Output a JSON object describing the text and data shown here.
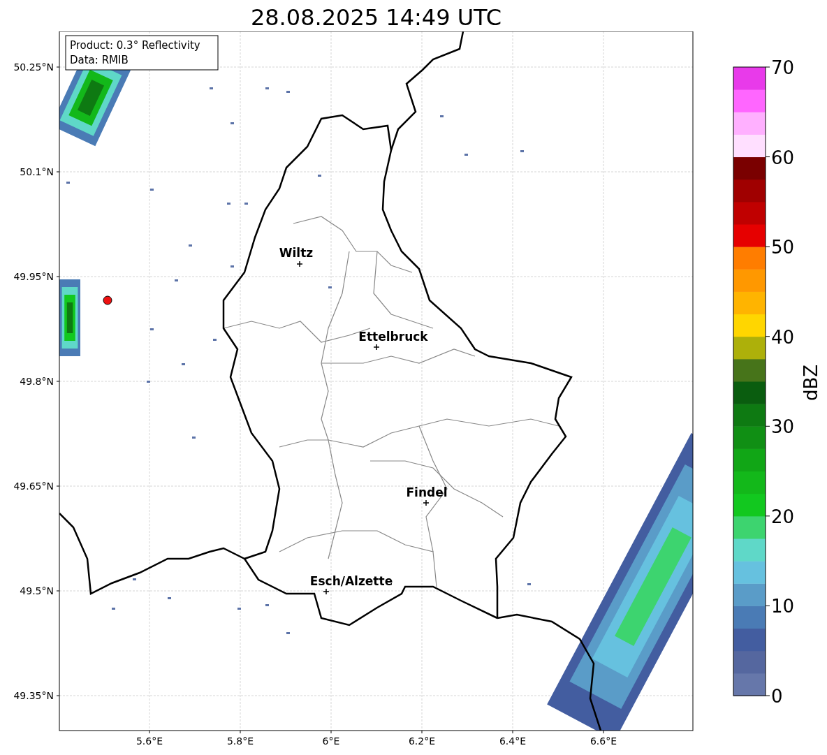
{
  "title": "28.08.2025 14:49 UTC",
  "info_box": [
    "Product: 0.3° Reflectivity",
    "Data: RMIB"
  ],
  "x_ticks": [
    "5.6°E",
    "5.8°E",
    "6°E",
    "6.2°E",
    "6.4°E",
    "6.6°E"
  ],
  "y_ticks": [
    "50.25°N",
    "50.1°N",
    "49.95°N",
    "49.8°N",
    "49.65°N",
    "49.5°N",
    "49.35°N"
  ],
  "cities": [
    {
      "name": "Wiltz"
    },
    {
      "name": "Ettelbruck"
    },
    {
      "name": "Findel"
    },
    {
      "name": "Esch/Alzette"
    }
  ],
  "colorbar": {
    "label": "dBZ",
    "ticks": [
      "70",
      "60",
      "50",
      "40",
      "30",
      "20",
      "10",
      "0"
    ],
    "segments": [
      {
        "color": "#6677aa"
      },
      {
        "color": "#55679f"
      },
      {
        "color": "#435da0"
      },
      {
        "color": "#4a7bb5"
      },
      {
        "color": "#5a9cc8"
      },
      {
        "color": "#66c1df"
      },
      {
        "color": "#5fd8c8"
      },
      {
        "color": "#3dd46f"
      },
      {
        "color": "#12c81f"
      },
      {
        "color": "#13b81a"
      },
      {
        "color": "#11a616"
      },
      {
        "color": "#108f14"
      },
      {
        "color": "#0e7a12"
      },
      {
        "color": "#0a5d0f"
      },
      {
        "color": "#47741a"
      },
      {
        "color": "#adb00a"
      },
      {
        "color": "#ffd600"
      },
      {
        "color": "#ffb400"
      },
      {
        "color": "#ff9800"
      },
      {
        "color": "#ff7d00"
      },
      {
        "color": "#e60000"
      },
      {
        "color": "#c00000"
      },
      {
        "color": "#a00000"
      },
      {
        "color": "#7a0000"
      },
      {
        "color": "#ffdfff"
      },
      {
        "color": "#ffb0ff"
      },
      {
        "color": "#ff66ff"
      },
      {
        "color": "#e83aea"
      }
    ]
  }
}
